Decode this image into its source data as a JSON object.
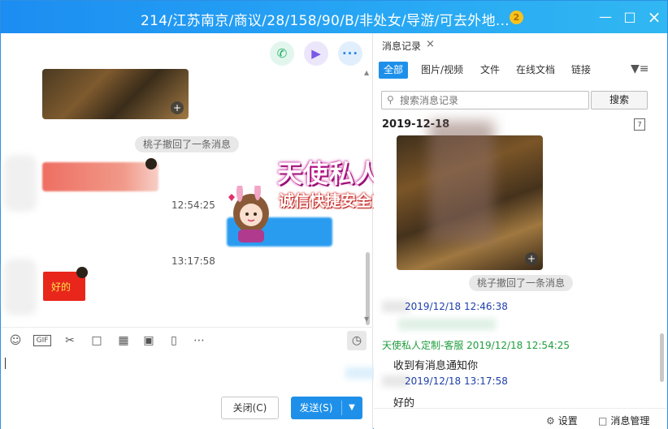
{
  "window": {
    "title": "214/江苏南京/商议/28/158/90/B/非处女/导游/可去外地...",
    "badge": "2",
    "minimize_icon": "minimize-icon",
    "maximize_icon": "maximize-icon",
    "close_icon": "close-icon"
  },
  "chat": {
    "header_buttons": [
      "phone-icon",
      "video-icon",
      "more-icon"
    ],
    "recall_notice": "桃子撤回了一条消息",
    "times": [
      "12:54:25",
      "13:17:58"
    ],
    "sticker_text": "好的",
    "toolbar_icons": [
      "emoji-icon",
      "gif-icon",
      "scissors-icon",
      "folder-icon",
      "screenshot-icon",
      "image-icon",
      "phone-screen-icon",
      "more-icon",
      "history-clock-icon"
    ],
    "gif_label": "GIF",
    "buttons": {
      "close": "关闭(C)",
      "send": "发送(S)"
    }
  },
  "overlay": {
    "title": "天使私人订制",
    "subtitle": "诚信快捷安全的交友平台"
  },
  "history": {
    "tab_label": "消息记录",
    "filters": [
      "全部",
      "图片/视频",
      "文件",
      "在线文档",
      "链接"
    ],
    "active_filter": "全部",
    "search_placeholder": "搜索消息记录",
    "search_button": "搜索",
    "date": "2019-12-18",
    "calendar_day": "7",
    "recall_notice": "桃子撤回了一条消息",
    "messages": [
      {
        "meta": "2019/12/18 12:46:38",
        "text": ""
      },
      {
        "meta": "天使私人定制-客服 2019/12/18 12:54:25",
        "text": "收到有消息通知你"
      },
      {
        "meta": "2019/12/18 13:17:58",
        "text": "好的"
      }
    ],
    "footer": {
      "settings": "设置",
      "manage": "消息管理"
    }
  },
  "colors": {
    "title_bar": "#1c8df2",
    "accent": "#1e90ea",
    "meta_green": "#1f9d3d",
    "meta_blue": "#1f3faa"
  }
}
